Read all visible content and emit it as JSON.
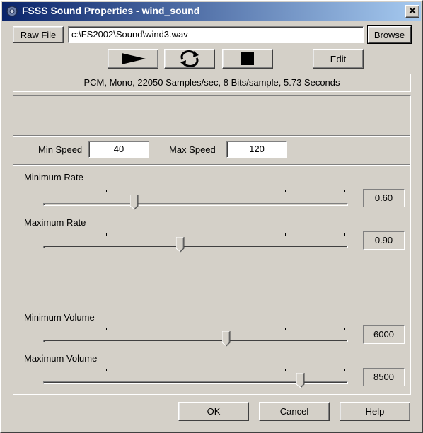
{
  "window": {
    "title": "FSSS Sound Properties - wind_sound",
    "close_label": "✕"
  },
  "file": {
    "raw_file_label": "Raw File",
    "path": "c:\\FS2002\\Sound\\wind3.wav",
    "browse_label": "Browse"
  },
  "playback": {
    "play_icon": "play-icon",
    "loop_icon": "loop-icon",
    "stop_icon": "stop-icon",
    "edit_label": "Edit"
  },
  "info": {
    "format_text": "PCM, Mono, 22050 Samples/sec, 8 Bits/sample, 5.73 Seconds"
  },
  "speed": {
    "min_label": "Min Speed",
    "min_value": "40",
    "max_label": "Max Speed",
    "max_value": "120"
  },
  "sliders": {
    "min_rate": {
      "label": "Minimum Rate",
      "value": "0.60",
      "position_fraction": 0.3
    },
    "max_rate": {
      "label": "Maximum Rate",
      "value": "0.90",
      "position_fraction": 0.45
    },
    "min_volume": {
      "label": "Minimum Volume",
      "value": "6000",
      "position_fraction": 0.6
    },
    "max_volume": {
      "label": "Maximum Volume",
      "value": "8500",
      "position_fraction": 0.845
    }
  },
  "footer": {
    "ok_label": "OK",
    "cancel_label": "Cancel",
    "help_label": "Help"
  }
}
